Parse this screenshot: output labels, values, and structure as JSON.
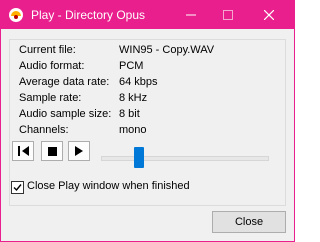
{
  "window": {
    "title": "Play - Directory Opus",
    "accent_color": "#e81f8c"
  },
  "info": [
    {
      "label": "Current file:",
      "value": "WIN95 - Copy.WAV"
    },
    {
      "label": "Audio format:",
      "value": "PCM"
    },
    {
      "label": "Average data rate:",
      "value": "64 kbps"
    },
    {
      "label": "Sample rate:",
      "value": "8 kHz"
    },
    {
      "label": "Audio sample size:",
      "value": "8 bit"
    },
    {
      "label": "Channels:",
      "value": "mono"
    }
  ],
  "transport": {
    "prev_icon": "skip-back-icon",
    "stop_icon": "stop-icon",
    "play_icon": "play-icon",
    "position_fraction": 0.21
  },
  "options": {
    "close_when_finished_label": "Close Play window when finished",
    "close_when_finished_checked": true
  },
  "buttons": {
    "close_label": "Close"
  }
}
